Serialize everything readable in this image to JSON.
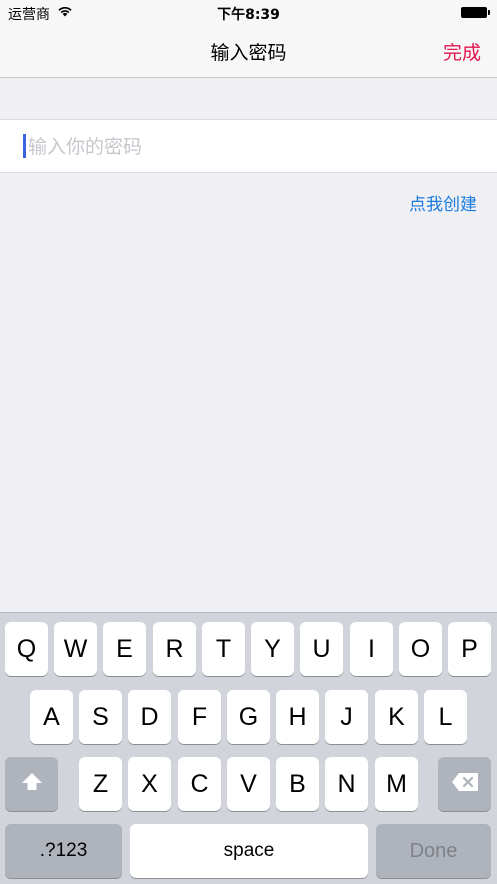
{
  "status_bar": {
    "carrier": "运营商",
    "time": "下午8:39"
  },
  "nav": {
    "title": "输入密码",
    "done_label": "完成"
  },
  "password_field": {
    "value": "",
    "placeholder": "输入你的密码"
  },
  "create_link": "点我创建",
  "keyboard": {
    "row1": [
      "Q",
      "W",
      "E",
      "R",
      "T",
      "Y",
      "U",
      "I",
      "O",
      "P"
    ],
    "row2": [
      "A",
      "S",
      "D",
      "F",
      "G",
      "H",
      "J",
      "K",
      "L"
    ],
    "row3": [
      "Z",
      "X",
      "C",
      "V",
      "B",
      "N",
      "M"
    ],
    "numbers_label": ".?123",
    "space_label": "space",
    "done_label": "Done",
    "shift_icon": "shift-icon",
    "delete_icon": "delete-icon"
  },
  "colors": {
    "accent_red": "#e3174f",
    "link_blue": "#1a7ce0",
    "cursor_blue": "#3a63e0"
  }
}
